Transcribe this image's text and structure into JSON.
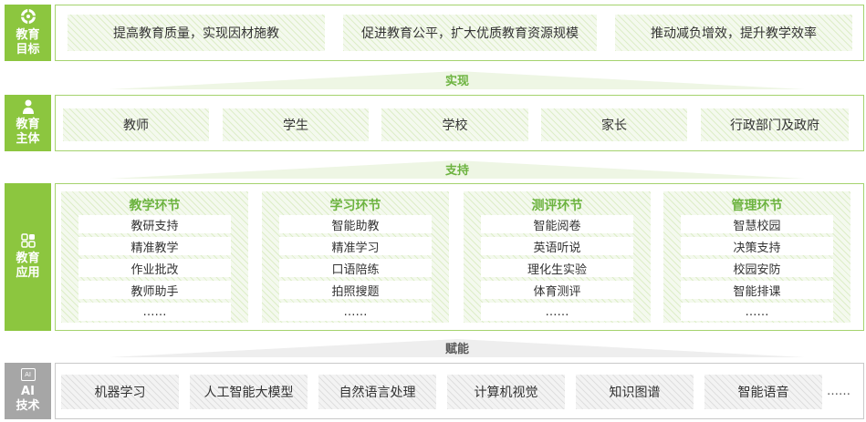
{
  "goals": {
    "label": "教育\n目标",
    "icon": "target-icon",
    "items": [
      "提高教育质量，实现因材施教",
      "促进教育公平，扩大优质教育资源规模",
      "推动减负增效，提升教学效率"
    ]
  },
  "connector_1": "实现",
  "subjects": {
    "label": "教育\n主体",
    "icon": "person-icon",
    "items": [
      "教师",
      "学生",
      "学校",
      "家长",
      "行政部门及政府"
    ]
  },
  "connector_2": "支持",
  "applications": {
    "label": "教育\n应用",
    "icon": "apps-icon",
    "panels": [
      {
        "title": "教学环节",
        "items": [
          "教研支持",
          "精准教学",
          "作业批改",
          "教师助手",
          "……"
        ]
      },
      {
        "title": "学习环节",
        "items": [
          "智能助教",
          "精准学习",
          "口语陪练",
          "拍照搜题",
          "……"
        ]
      },
      {
        "title": "测评环节",
        "items": [
          "智能阅卷",
          "英语听说",
          "理化生实验",
          "体育测评",
          "……"
        ]
      },
      {
        "title": "管理环节",
        "items": [
          "智慧校园",
          "决策支持",
          "校园安防",
          "智能排课",
          "……"
        ]
      }
    ]
  },
  "connector_3": "赋能",
  "ai": {
    "label": "AI\n技术",
    "icon": "ai-icon",
    "icon_text": "AI",
    "items": [
      "机器学习",
      "人工智能大模型",
      "自然语言处理",
      "计算机视觉",
      "知识图谱",
      "智能语音"
    ],
    "more": "……"
  },
  "colors": {
    "green": "#8cc63f",
    "green_text": "#6cb33f",
    "gray": "#a6a6a6",
    "gray_text": "#595959"
  }
}
